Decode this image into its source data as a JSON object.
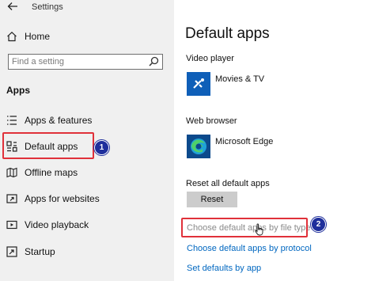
{
  "window": {
    "title": "Settings"
  },
  "sidebar": {
    "home_label": "Home",
    "search_placeholder": "Find a setting",
    "section_title": "Apps",
    "items": [
      {
        "label": "Apps & features",
        "icon": "list-icon"
      },
      {
        "label": "Default apps",
        "icon": "default-apps-icon",
        "selected": true
      },
      {
        "label": "Offline maps",
        "icon": "map-icon"
      },
      {
        "label": "Apps for websites",
        "icon": "web-link-icon"
      },
      {
        "label": "Video playback",
        "icon": "video-icon"
      },
      {
        "label": "Startup",
        "icon": "startup-icon"
      }
    ]
  },
  "main": {
    "title": "Default apps",
    "video_player": {
      "label": "Video player",
      "app": "Movies & TV"
    },
    "web_browser": {
      "label": "Web browser",
      "app": "Microsoft Edge"
    },
    "reset": {
      "label": "Reset all default apps",
      "button": "Reset"
    },
    "links": [
      "Choose default apps by file type",
      "Choose default apps by protocol",
      "Set defaults by app"
    ]
  },
  "annotations": {
    "badge_1": "1",
    "badge_2": "2"
  },
  "colors": {
    "accent": "#0067c0",
    "highlight": "#e0313a",
    "badge": "#1f2f9c",
    "sidebar_bg": "#f0f0f0"
  }
}
